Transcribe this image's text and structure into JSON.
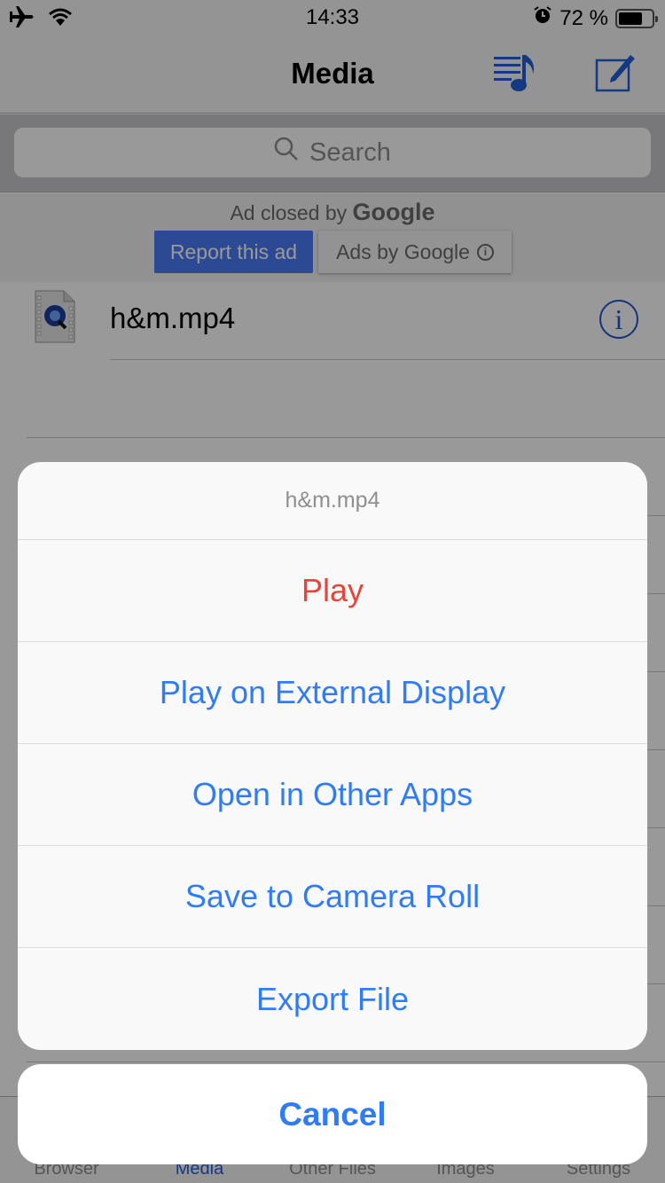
{
  "status_bar": {
    "time": "14:33",
    "battery_text": "72 %",
    "battery_level": 0.72,
    "icons": [
      "airplane-icon",
      "wifi-icon",
      "alarm-icon",
      "battery-icon"
    ]
  },
  "nav": {
    "title": "Media",
    "buttons": [
      {
        "name": "playlist-button",
        "icon": "music-playlist-icon"
      },
      {
        "name": "edit-button",
        "icon": "compose-icon"
      }
    ]
  },
  "search": {
    "placeholder": "Search",
    "icon": "search-icon"
  },
  "ad": {
    "closed_text": "Ad closed by",
    "closed_brand": "Google",
    "report_label": "Report this ad",
    "ads_by_label": "Ads by Google",
    "info_glyph": "i"
  },
  "files": [
    {
      "name": "h&m.mp4",
      "icon": "quicktime-video-file-icon",
      "info_glyph": "i"
    }
  ],
  "tabbar": {
    "tabs": [
      {
        "label": "Browser",
        "active": false
      },
      {
        "label": "Media",
        "active": true
      },
      {
        "label": "Other Files",
        "active": false
      },
      {
        "label": "Images",
        "active": false
      },
      {
        "label": "Settings",
        "active": false
      }
    ]
  },
  "action_sheet": {
    "title": "h&m.mp4",
    "actions": [
      {
        "label": "Play",
        "style": "destructive"
      },
      {
        "label": "Play on External Display",
        "style": "default"
      },
      {
        "label": "Open in Other Apps",
        "style": "default"
      },
      {
        "label": "Save to Camera Roll",
        "style": "default"
      },
      {
        "label": "Export File",
        "style": "default"
      }
    ],
    "cancel_label": "Cancel"
  },
  "colors": {
    "accent": "#2f7cf6",
    "destructive": "#e8443a",
    "nav_icon": "#2255cc",
    "ad_button": "#4a7bf7"
  }
}
